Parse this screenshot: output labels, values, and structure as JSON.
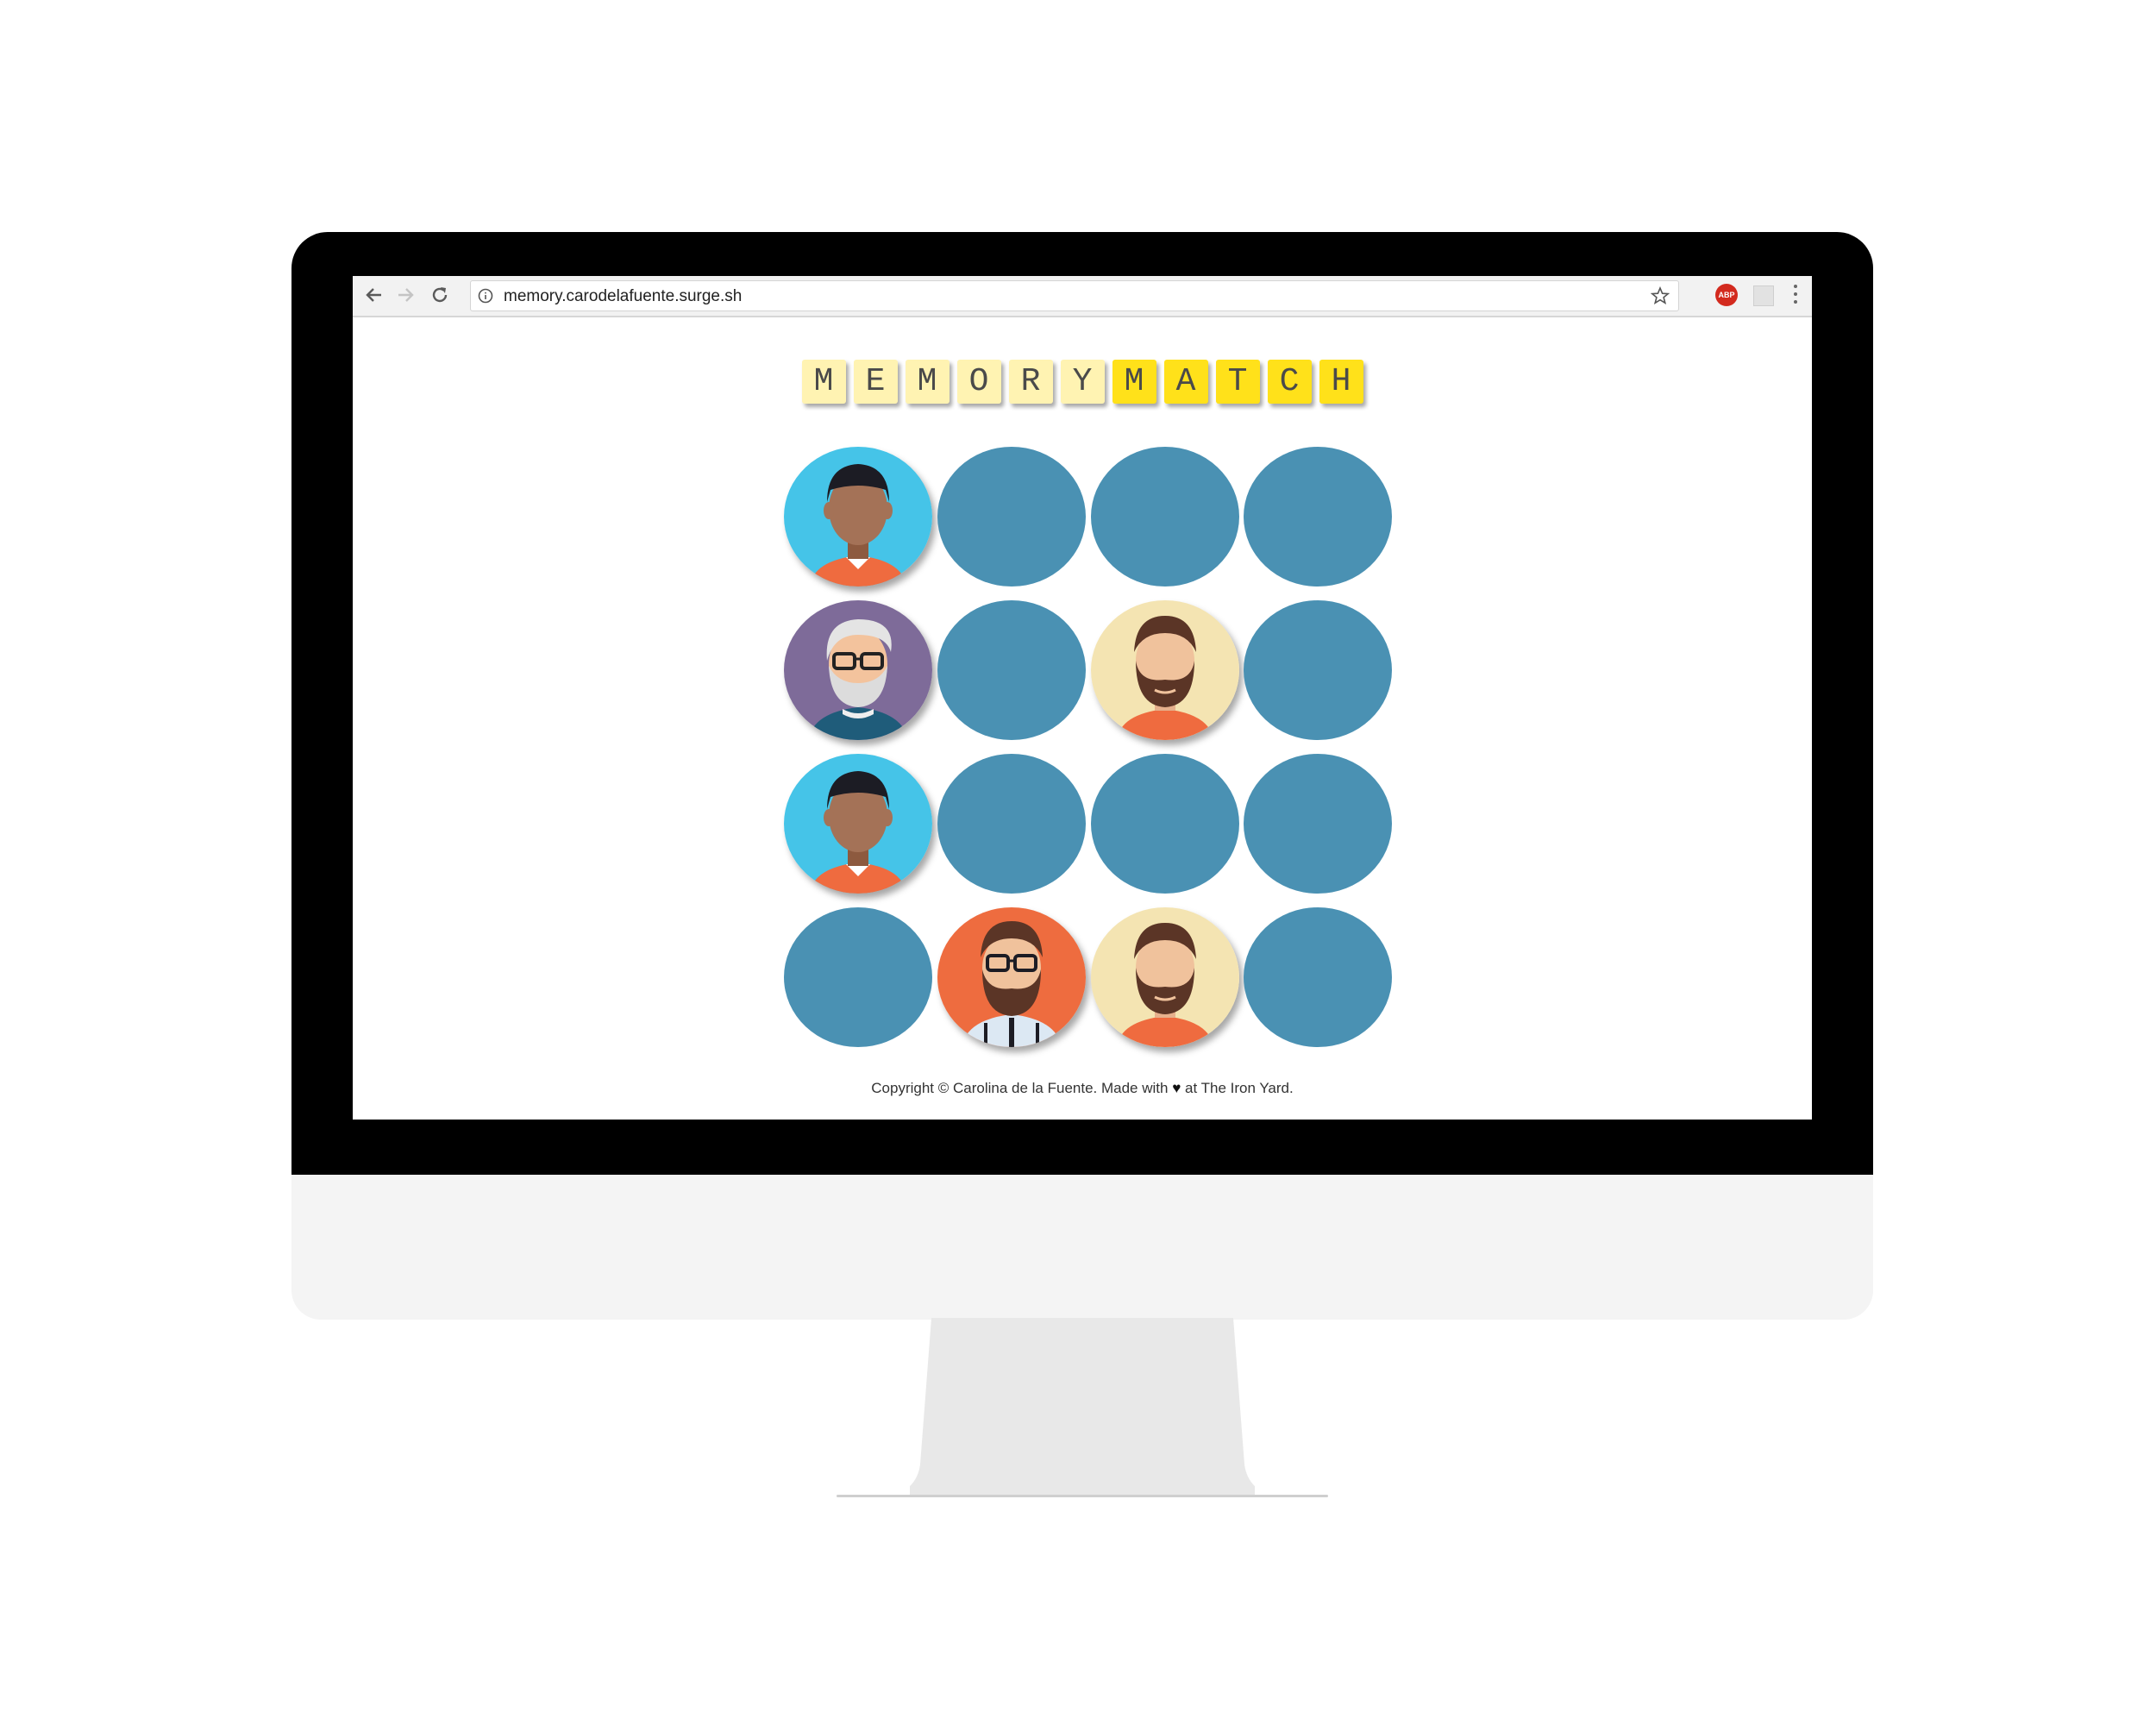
{
  "browser": {
    "url": "memory.carodelafuente.surge.sh",
    "extension_label": "ABP",
    "icons": [
      "back-arrow-icon",
      "forward-arrow-icon",
      "reload-icon",
      "info-icon",
      "star-icon",
      "adblock-icon",
      "extension-icon",
      "menu-icon"
    ]
  },
  "game": {
    "title_letters": [
      {
        "char": "M",
        "style": "light"
      },
      {
        "char": "E",
        "style": "light"
      },
      {
        "char": "M",
        "style": "light"
      },
      {
        "char": "O",
        "style": "light"
      },
      {
        "char": "R",
        "style": "light"
      },
      {
        "char": "Y",
        "style": "light"
      },
      {
        "char": "M",
        "style": "bright"
      },
      {
        "char": "A",
        "style": "bright"
      },
      {
        "char": "T",
        "style": "bright"
      },
      {
        "char": "C",
        "style": "bright"
      },
      {
        "char": "H",
        "style": "bright"
      }
    ],
    "cards": [
      [
        "dark-hair-man",
        "hidden",
        "hidden",
        "hidden"
      ],
      [
        "old-man-glasses",
        "hidden",
        "bearded-man",
        "hidden"
      ],
      [
        "dark-hair-man",
        "hidden",
        "hidden",
        "hidden"
      ],
      [
        "hidden",
        "hipster-glasses",
        "bearded-man",
        "hidden"
      ]
    ],
    "colors": {
      "card_back": "#4a91b3",
      "title_light": "#fff3b2",
      "title_bright": "#ffe11a"
    }
  },
  "footer": {
    "text_before": "Copyright © Carolina de la Fuente. Made with ",
    "heart": "♥",
    "text_after": " at The Iron Yard."
  }
}
